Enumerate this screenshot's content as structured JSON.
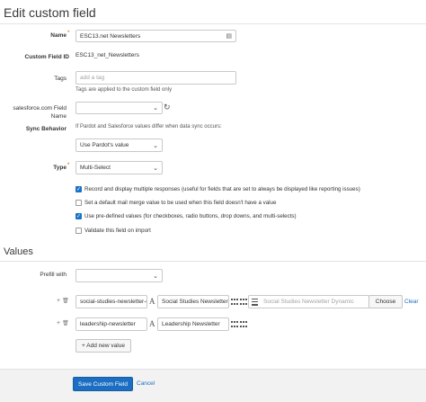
{
  "page": {
    "title": "Edit custom field"
  },
  "form": {
    "name": {
      "label": "Name",
      "value": "ESC13.net Newsletters"
    },
    "custom_field_id": {
      "label": "Custom Field ID",
      "value": "ESC13_net_Newsletters"
    },
    "tags": {
      "label": "Tags",
      "placeholder": "add a tag",
      "help": "Tags are applied to the custom field only"
    },
    "salesforce_field": {
      "label_line1": "salesforce.com Field",
      "label_line2": "Name",
      "value": ""
    },
    "sync_behavior": {
      "label": "Sync Behavior",
      "help": "If Pardot and Salesforce values differ when data sync occurs:",
      "value": "Use Pardot's value"
    },
    "type": {
      "label": "Type",
      "value": "Multi-Select"
    },
    "checkboxes": [
      {
        "label": "Record and display multiple responses (useful for fields that are set to always be displayed like reporting issues)",
        "checked": true
      },
      {
        "label": "Set a default mail merge value to be used when this field doesn't have a value",
        "checked": false
      },
      {
        "label": "Use pre-defined values (for checkboxes, radio buttons, drop downs, and multi-selects)",
        "checked": true
      },
      {
        "label": "Validate this field on import",
        "checked": false
      }
    ]
  },
  "values": {
    "title": "Values",
    "prefill_label": "Prefill with",
    "prefill_value": "",
    "rows": [
      {
        "value": "social-studies-newsletter-d",
        "label": "Social Studies Newsletter",
        "list_placeholder": "Social Studies Newsletter Dynamic",
        "choose": "Choose",
        "clear": "Clear"
      },
      {
        "value": "leadership-newsletter",
        "label": "Leadership Newsletter"
      }
    ],
    "add_button": "+ Add new value"
  },
  "footer": {
    "save": "Save Custom Field",
    "cancel": "Cancel"
  },
  "icons": {
    "checkmark": "✓",
    "chevron": "⌄",
    "sync": "↻",
    "plus": "+",
    "trash": "🗑",
    "font": "A"
  },
  "colors": {
    "primary": "#1b6ec2",
    "required": "#e8912b"
  }
}
